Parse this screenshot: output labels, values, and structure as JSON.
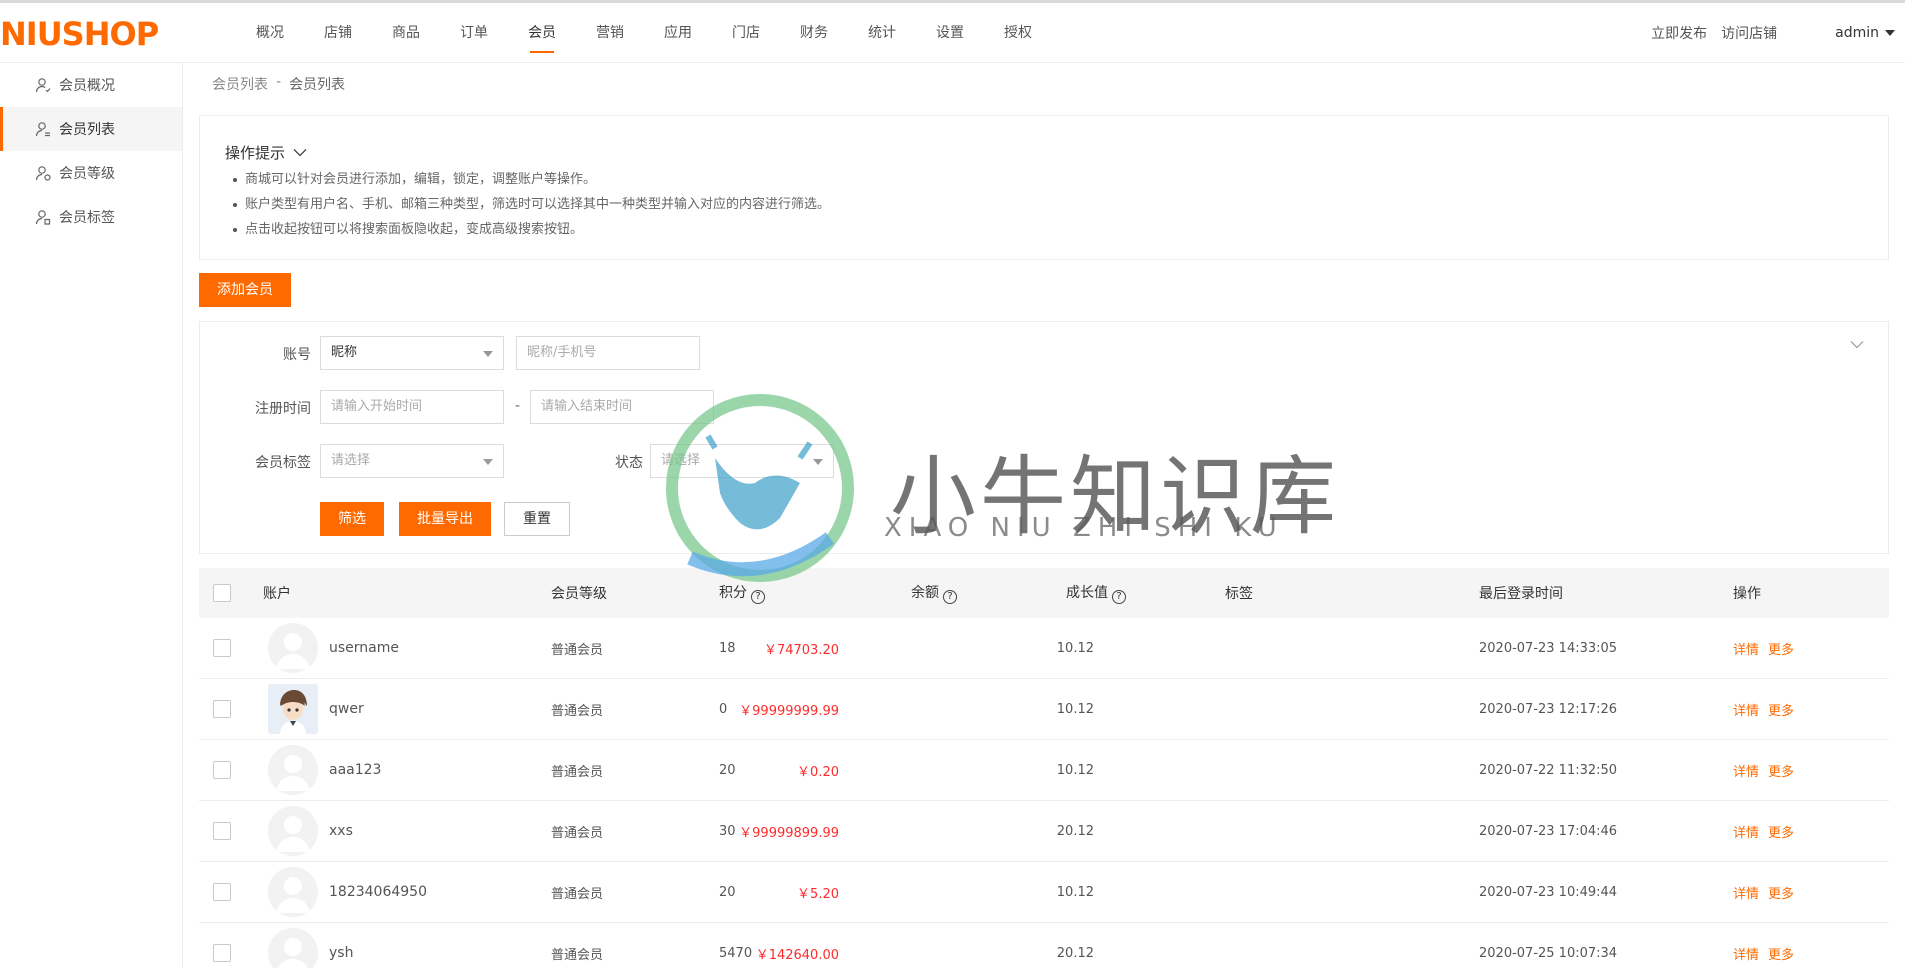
{
  "brand": {
    "logo_text": "NIUSHOP"
  },
  "nav": {
    "items": [
      {
        "label": "概况"
      },
      {
        "label": "店铺"
      },
      {
        "label": "商品"
      },
      {
        "label": "订单"
      },
      {
        "label": "会员"
      },
      {
        "label": "营销"
      },
      {
        "label": "应用"
      },
      {
        "label": "门店"
      },
      {
        "label": "财务"
      },
      {
        "label": "统计"
      },
      {
        "label": "设置"
      },
      {
        "label": "授权"
      }
    ],
    "active": "会员"
  },
  "top_right": {
    "publish": "立即发布",
    "visit": "访问店铺",
    "user": "admin"
  },
  "sidebar": {
    "items": [
      {
        "label": "会员概况"
      },
      {
        "label": "会员列表"
      },
      {
        "label": "会员等级"
      },
      {
        "label": "会员标签"
      }
    ]
  },
  "breadcrumb": {
    "parent": "会员列表",
    "sep": "-",
    "current": "会员列表"
  },
  "tips": {
    "title": "操作提示",
    "items": [
      "商城可以针对会员进行添加，编辑，锁定，调整账户等操作。",
      "账户类型有用户名、手机、邮箱三种类型，筛选时可以选择其中一种类型并输入对应的内容进行筛选。",
      "点击收起按钮可以将搜索面板隐收起，变成高级搜索按钮。"
    ]
  },
  "add_button": "添加会员",
  "filter": {
    "account_label": "账号",
    "account_type": "昵称",
    "account_placeholder": "昵称/手机号",
    "reg_time_label": "注册时间",
    "start_placeholder": "请输入开始时间",
    "dash": "-",
    "end_placeholder": "请输入结束时间",
    "tag_label": "会员标签",
    "tag_placeholder": "请选择",
    "status_label": "状态",
    "status_placeholder": "请选择",
    "filter_btn": "筛选",
    "export_btn": "批量导出",
    "reset_btn": "重置"
  },
  "table": {
    "headers": {
      "account": "账户",
      "level": "会员等级",
      "points": "积分",
      "balance": "余额",
      "growth": "成长值",
      "tags": "标签",
      "last_login": "最后登录时间",
      "ops": "操作"
    },
    "rows": [
      {
        "account": "username",
        "level": "普通会员",
        "points": "18",
        "balance": "￥74703.20",
        "growth": "10.12",
        "last_login": "2020-07-23 14:33:05",
        "detail": "详情",
        "more": "更多",
        "avatar": "default"
      },
      {
        "account": "qwer",
        "level": "普通会员",
        "points": "0",
        "balance": "￥99999999.99",
        "growth": "10.12",
        "last_login": "2020-07-23 12:17:26",
        "detail": "详情",
        "more": "更多",
        "avatar": "photo"
      },
      {
        "account": "aaa123",
        "level": "普通会员",
        "points": "20",
        "balance": "￥0.20",
        "growth": "10.12",
        "last_login": "2020-07-22 11:32:50",
        "detail": "详情",
        "more": "更多",
        "avatar": "default"
      },
      {
        "account": "xxs",
        "level": "普通会员",
        "points": "30",
        "balance": "￥99999899.99",
        "growth": "20.12",
        "last_login": "2020-07-23 17:04:46",
        "detail": "详情",
        "more": "更多",
        "avatar": "default"
      },
      {
        "account": "18234064950",
        "level": "普通会员",
        "points": "20",
        "balance": "￥5.20",
        "growth": "10.12",
        "last_login": "2020-07-23 10:49:44",
        "detail": "详情",
        "more": "更多",
        "avatar": "default"
      },
      {
        "account": "ysh",
        "level": "普通会员",
        "points": "5470",
        "balance": "￥142640.00",
        "growth": "20.12",
        "last_login": "2020-07-25 10:07:34",
        "detail": "详情",
        "more": "更多",
        "avatar": "default"
      }
    ]
  },
  "watermark": {
    "title": "小牛知识库",
    "subtitle": "XIAO NIU ZHI SHI KU"
  },
  "colors": {
    "accent": "#ff6a00",
    "money": "#ff2b2b"
  }
}
